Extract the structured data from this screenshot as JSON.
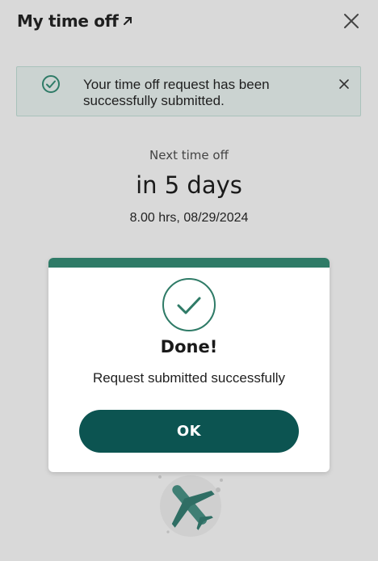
{
  "header": {
    "title": "My time off",
    "title_icon": "external-arrow-icon",
    "close_icon": "close-icon"
  },
  "banner": {
    "icon": "check-circle-icon",
    "message": "Your time off request has been successfully submitted.",
    "dismiss_icon": "close-icon"
  },
  "next_time_off": {
    "label": "Next time off",
    "value": "in 5 days",
    "detail": "8.00 hrs, 08/29/2024"
  },
  "illustration": {
    "icon": "airplane-icon"
  },
  "dialog": {
    "icon": "check-circle-icon",
    "title": "Done!",
    "message": "Request submitted successfully",
    "ok_label": "OK"
  },
  "colors": {
    "accent": "#2f7b67",
    "button": "#0c5451",
    "banner_bg": "#cbd3d1",
    "overlay_bg": "#d9d9d9"
  }
}
